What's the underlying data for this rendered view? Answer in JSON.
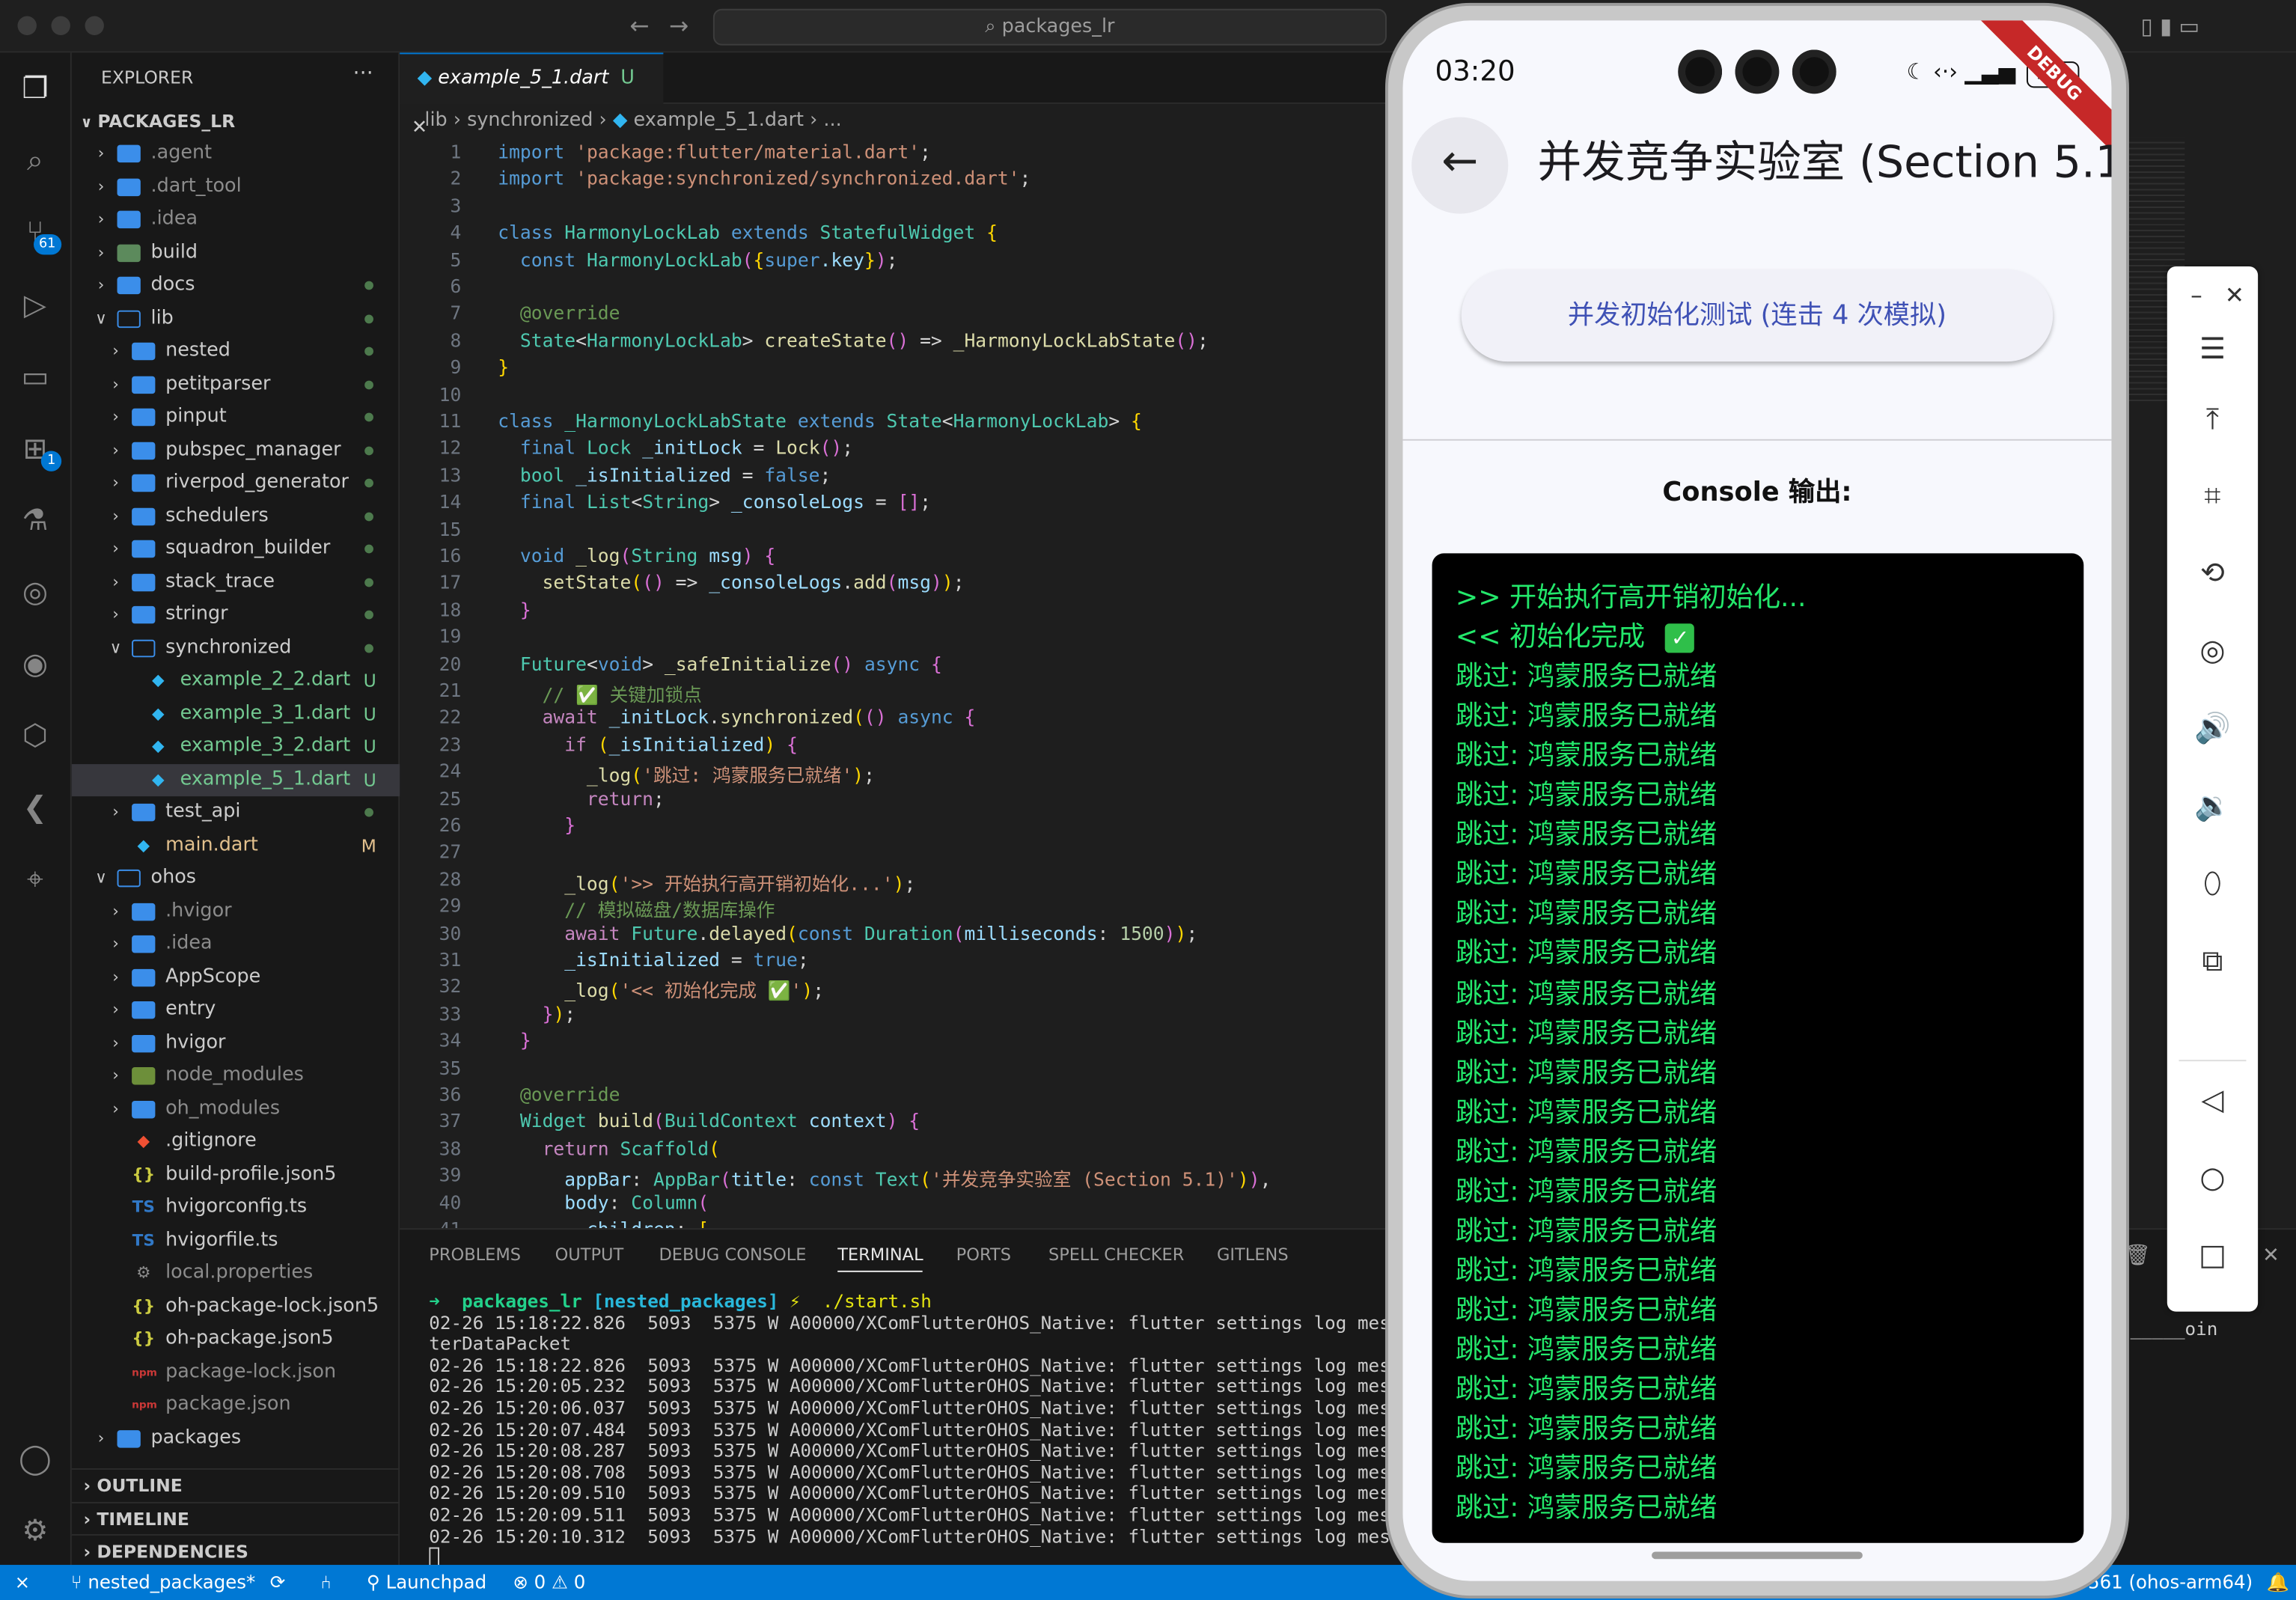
{
  "window": {
    "search": "packages_lr"
  },
  "colors": {
    "accent": "#0078d4",
    "console_text": "#23e86b",
    "folder": "#3b8eea"
  },
  "activity_bar": {
    "scm_badge": "61",
    "ext_badge": "1"
  },
  "explorer": {
    "title": "EXPLORER",
    "root": "PACKAGES_LR",
    "items": [
      {
        "name": ".agent",
        "depth": 1,
        "kind": "folder"
      },
      {
        "name": ".dart_tool",
        "depth": 1,
        "kind": "folder"
      },
      {
        "name": ".idea",
        "depth": 1,
        "kind": "folder"
      },
      {
        "name": "build",
        "depth": 1,
        "kind": "folder-build"
      },
      {
        "name": "docs",
        "depth": 1,
        "kind": "folder",
        "dot": true
      },
      {
        "name": "lib",
        "depth": 1,
        "kind": "folder-open",
        "dot": true
      },
      {
        "name": "nested",
        "depth": 2,
        "kind": "folder",
        "dot": true
      },
      {
        "name": "petitparser",
        "depth": 2,
        "kind": "folder",
        "dot": true
      },
      {
        "name": "pinput",
        "depth": 2,
        "kind": "folder",
        "dot": true
      },
      {
        "name": "pubspec_manager",
        "depth": 2,
        "kind": "folder",
        "dot": true
      },
      {
        "name": "riverpod_generator",
        "depth": 2,
        "kind": "folder",
        "dot": true
      },
      {
        "name": "schedulers",
        "depth": 2,
        "kind": "folder",
        "dot": true
      },
      {
        "name": "squadron_builder",
        "depth": 2,
        "kind": "folder",
        "dot": true
      },
      {
        "name": "stack_trace",
        "depth": 2,
        "kind": "folder",
        "dot": true
      },
      {
        "name": "stringr",
        "depth": 2,
        "kind": "folder",
        "dot": true
      },
      {
        "name": "synchronized",
        "depth": 2,
        "kind": "folder-open",
        "dot": true
      },
      {
        "name": "example_2_2.dart",
        "depth": 3,
        "kind": "dart",
        "status": "U"
      },
      {
        "name": "example_3_1.dart",
        "depth": 3,
        "kind": "dart",
        "status": "U"
      },
      {
        "name": "example_3_2.dart",
        "depth": 3,
        "kind": "dart",
        "status": "U"
      },
      {
        "name": "example_5_1.dart",
        "depth": 3,
        "kind": "dart",
        "status": "U",
        "selected": true
      },
      {
        "name": "test_api",
        "depth": 2,
        "kind": "folder",
        "dot": true
      },
      {
        "name": "main.dart",
        "depth": 2,
        "kind": "dart-file",
        "status": "M"
      },
      {
        "name": "ohos",
        "depth": 1,
        "kind": "folder-open"
      },
      {
        "name": ".hvigor",
        "depth": 2,
        "kind": "folder"
      },
      {
        "name": ".idea",
        "depth": 2,
        "kind": "folder"
      },
      {
        "name": "AppScope",
        "depth": 2,
        "kind": "folder"
      },
      {
        "name": "entry",
        "depth": 2,
        "kind": "folder"
      },
      {
        "name": "hvigor",
        "depth": 2,
        "kind": "folder"
      },
      {
        "name": "node_modules",
        "depth": 2,
        "kind": "folder-node"
      },
      {
        "name": "oh_modules",
        "depth": 2,
        "kind": "folder"
      },
      {
        "name": ".gitignore",
        "depth": 2,
        "kind": "git"
      },
      {
        "name": "build-profile.json5",
        "depth": 2,
        "kind": "json"
      },
      {
        "name": "hvigorconfig.ts",
        "depth": 2,
        "kind": "ts"
      },
      {
        "name": "hvigorfile.ts",
        "depth": 2,
        "kind": "ts"
      },
      {
        "name": "local.properties",
        "depth": 2,
        "kind": "gear"
      },
      {
        "name": "oh-package-lock.json5",
        "depth": 2,
        "kind": "json"
      },
      {
        "name": "oh-package.json5",
        "depth": 2,
        "kind": "json"
      },
      {
        "name": "package-lock.json",
        "depth": 2,
        "kind": "npm"
      },
      {
        "name": "package.json",
        "depth": 2,
        "kind": "npm"
      },
      {
        "name": "packages",
        "depth": 1,
        "kind": "folder"
      }
    ],
    "sections": [
      "OUTLINE",
      "TIMELINE",
      "DEPENDENCIES"
    ]
  },
  "editor": {
    "tab_name": "example_5_1.dart",
    "tab_status": "U",
    "breadcrumb": [
      "lib",
      "synchronized",
      "example_5_1.dart",
      "..."
    ],
    "lines": [
      [
        [
          "k",
          "import "
        ],
        [
          "s",
          "'package:flutter/material.dart'"
        ],
        [
          "",
          "; "
        ]
      ],
      [
        [
          "k",
          "import "
        ],
        [
          "s",
          "'package:synchronized/synchronized.dart'"
        ],
        [
          "",
          ";"
        ]
      ],
      [],
      [
        [
          "k",
          "class "
        ],
        [
          "t",
          "HarmonyLockLab "
        ],
        [
          "k",
          "extends "
        ],
        [
          "t",
          "StatefulWidget "
        ],
        [
          "y",
          "{"
        ]
      ],
      [
        [
          "",
          ""
        ],
        [
          "k",
          "  const "
        ],
        [
          "t",
          "HarmonyLockLab"
        ],
        [
          "m",
          "("
        ],
        [
          "y",
          "{"
        ],
        [
          "k",
          "super"
        ],
        [
          "v",
          ".key"
        ],
        [
          "y",
          "}"
        ],
        [
          "m",
          ")"
        ],
        [
          "",
          ";"
        ]
      ],
      [],
      [
        [
          "c",
          "  @override"
        ]
      ],
      [
        [
          "t",
          "  State"
        ],
        [
          "",
          "<"
        ],
        [
          "t",
          "HarmonyLockLab"
        ],
        [
          "",
          "> "
        ],
        [
          "f",
          "createState"
        ],
        [
          "m",
          "()"
        ],
        [
          "",
          " => "
        ],
        [
          "f",
          "_HarmonyLockLabState"
        ],
        [
          "m",
          "()"
        ],
        [
          "",
          ";"
        ]
      ],
      [
        [
          "y",
          "}"
        ]
      ],
      [],
      [
        [
          "k",
          "class "
        ],
        [
          "t",
          "_HarmonyLockLabState "
        ],
        [
          "k",
          "extends "
        ],
        [
          "t",
          "State"
        ],
        [
          "",
          "<"
        ],
        [
          "t",
          "HarmonyLockLab"
        ],
        [
          "",
          "> "
        ],
        [
          "y",
          "{"
        ]
      ],
      [
        [
          "k",
          "  final "
        ],
        [
          "t",
          "Lock "
        ],
        [
          "v",
          "_initLock"
        ],
        [
          "",
          " = "
        ],
        [
          "f",
          "Lock"
        ],
        [
          "m",
          "()"
        ],
        [
          "",
          ";"
        ]
      ],
      [
        [
          "t",
          "  bool "
        ],
        [
          "v",
          "_isInitialized"
        ],
        [
          "",
          " = "
        ],
        [
          "k",
          "false"
        ],
        [
          "",
          ";"
        ]
      ],
      [
        [
          "k",
          "  final "
        ],
        [
          "t",
          "List"
        ],
        [
          "",
          "<"
        ],
        [
          "t",
          "String"
        ],
        [
          "",
          "> "
        ],
        [
          "v",
          "_consoleLogs"
        ],
        [
          "",
          " = "
        ],
        [
          "m",
          "[]"
        ],
        [
          "",
          ";"
        ]
      ],
      [],
      [
        [
          "k",
          "  void "
        ],
        [
          "f",
          "_log"
        ],
        [
          "m",
          "("
        ],
        [
          "t",
          "String "
        ],
        [
          "v",
          "msg"
        ],
        [
          "m",
          ")"
        ],
        [
          "",
          " "
        ],
        [
          "m",
          "{"
        ]
      ],
      [
        [
          "f",
          "    setState"
        ],
        [
          "y",
          "("
        ],
        [
          "m",
          "()"
        ],
        [
          "",
          " => "
        ],
        [
          "v",
          "_consoleLogs"
        ],
        [
          "",
          ".",
          ""
        ],
        [
          "f",
          "add"
        ],
        [
          "m",
          "("
        ],
        [
          "v",
          "msg"
        ],
        [
          "m",
          ")"
        ],
        [
          "y",
          ")"
        ],
        [
          "",
          ";"
        ]
      ],
      [
        [
          "m",
          "  }"
        ]
      ],
      [],
      [
        [
          "t",
          "  Future"
        ],
        [
          "",
          "<"
        ],
        [
          "k",
          "void"
        ],
        [
          "",
          "> "
        ],
        [
          "f",
          "_safeInitialize"
        ],
        [
          "m",
          "()"
        ],
        [
          "k",
          " async "
        ],
        [
          "m",
          "{"
        ]
      ],
      [
        [
          "c",
          "    // ✅ 关键加锁点"
        ]
      ],
      [
        [
          "p",
          "    await "
        ],
        [
          "v",
          "_initLock"
        ],
        [
          "",
          "."
        ],
        [
          "f",
          "synchronized"
        ],
        [
          "y",
          "("
        ],
        [
          "m",
          "()"
        ],
        [
          "k",
          " async "
        ],
        [
          "m",
          "{"
        ]
      ],
      [
        [
          "p",
          "      if "
        ],
        [
          "y",
          "("
        ],
        [
          "v",
          "_isInitialized"
        ],
        [
          "y",
          ")"
        ],
        [
          "",
          " "
        ],
        [
          "m",
          "{"
        ]
      ],
      [
        [
          "f",
          "        _log"
        ],
        [
          "y",
          "("
        ],
        [
          "s",
          "'跳过: 鸿蒙服务已就绪'"
        ],
        [
          "y",
          ")"
        ],
        [
          "",
          ";"
        ]
      ],
      [
        [
          "p",
          "        return"
        ],
        [
          "",
          ";"
        ]
      ],
      [
        [
          "m",
          "      }"
        ]
      ],
      [],
      [
        [
          "f",
          "      _log"
        ],
        [
          "y",
          "("
        ],
        [
          "s",
          "'>> 开始执行高开销初始化...'"
        ],
        [
          "y",
          ")"
        ],
        [
          "",
          ";"
        ]
      ],
      [
        [
          "c",
          "      // 模拟磁盘/数据库操作"
        ]
      ],
      [
        [
          "p",
          "      await "
        ],
        [
          "t",
          "Future"
        ],
        [
          "",
          "."
        ],
        [
          "f",
          "delayed"
        ],
        [
          "y",
          "("
        ],
        [
          "k",
          "const "
        ],
        [
          "t",
          "Duration"
        ],
        [
          "m",
          "("
        ],
        [
          "v",
          "milliseconds"
        ],
        [
          "",
          ": "
        ],
        [
          "n",
          "1500"
        ],
        [
          "m",
          ")"
        ],
        [
          "y",
          ")"
        ],
        [
          "",
          ";"
        ]
      ],
      [
        [
          "v",
          "      _isInitialized"
        ],
        [
          "",
          " = "
        ],
        [
          "k",
          "true"
        ],
        [
          "",
          ";"
        ]
      ],
      [
        [
          "f",
          "      _log"
        ],
        [
          "y",
          "("
        ],
        [
          "s",
          "'<< 初始化完成 ✅'"
        ],
        [
          "y",
          ")"
        ],
        [
          "",
          ";"
        ]
      ],
      [
        [
          "m",
          "    }"
        ],
        [
          "y",
          ")"
        ],
        [
          "",
          ";"
        ]
      ],
      [
        [
          "m",
          "  }"
        ]
      ],
      [],
      [
        [
          "c",
          "  @override"
        ]
      ],
      [
        [
          "t",
          "  Widget "
        ],
        [
          "f",
          "build"
        ],
        [
          "m",
          "("
        ],
        [
          "t",
          "BuildContext "
        ],
        [
          "v",
          "context"
        ],
        [
          "m",
          ")"
        ],
        [
          "",
          " "
        ],
        [
          "m",
          "{"
        ]
      ],
      [
        [
          "p",
          "    return "
        ],
        [
          "t",
          "Scaffold"
        ],
        [
          "y",
          "("
        ]
      ],
      [
        [
          "v",
          "      appBar"
        ],
        [
          "",
          ": "
        ],
        [
          "t",
          "AppBar"
        ],
        [
          "m",
          "("
        ],
        [
          "v",
          "title"
        ],
        [
          "",
          ": "
        ],
        [
          "k",
          "const "
        ],
        [
          "t",
          "Text"
        ],
        [
          "y",
          "("
        ],
        [
          "s",
          "'并发竞争实验室 (Section 5.1)'"
        ],
        [
          "y",
          ")"
        ],
        [
          "m",
          ")"
        ],
        [
          "",
          ","
        ]
      ],
      [
        [
          "v",
          "      body"
        ],
        [
          "",
          ": "
        ],
        [
          "t",
          "Column"
        ],
        [
          "m",
          "("
        ]
      ],
      [
        [
          "v",
          "        children"
        ],
        [
          "",
          ": "
        ],
        [
          "y",
          "["
        ]
      ]
    ]
  },
  "panel": {
    "tabs": [
      "PROBLEMS",
      "OUTPUT",
      "DEBUG CONSOLE",
      "TERMINAL",
      "PORTS",
      "SPELL CHECKER",
      "GITLENS"
    ],
    "active_tab": "TERMINAL",
    "prompt_dir": "packages_lr",
    "prompt_branch": "[nested_packages]",
    "prompt_cmd": "./start.sh",
    "log_lines": [
      "02-26 15:18:22.826  5093  5375 W A00000/XComFlutterOHOS_Native: flutter settings log message",
      "terDataPacket",
      "02-26 15:18:22.826  5093  5375 W A00000/XComFlutterOHOS_Native: flutter settings log message",
      "02-26 15:20:05.232  5093  5375 W A00000/XComFlutterOHOS_Native: flutter settings log message",
      "02-26 15:20:06.037  5093  5375 W A00000/XComFlutterOHOS_Native: flutter settings log message",
      "02-26 15:20:07.484  5093  5375 W A00000/XComFlutterOHOS_Native: flutter settings log message",
      "02-26 15:20:08.287  5093  5375 W A00000/XComFlutterOHOS_Native: flutter settings log message",
      "02-26 15:20:08.708  5093  5375 W A00000/XComFlutterOHOS_Native: flutter settings log message",
      "02-26 15:20:09.510  5093  5375 W A00000/XComFlutterOHOS_Native: flutter settings log message",
      "02-26 15:20:09.511  5093  5375 W A00000/XComFlutterOHOS_Native: flutter settings log message",
      "02-26 15:20:10.312  5093  5375 W A00000/XComFlutterOHOS_Native: flutter settings log message"
    ],
    "right_fragment": "ing._____oin"
  },
  "status_bar": {
    "branch": "nested_packages*",
    "launchpad": "Launchpad",
    "errors": "0",
    "warnings": "0",
    "device": "5561 (ohos-arm64)"
  },
  "phone": {
    "time": "03:20",
    "battery": "100",
    "debug_banner": "DEBUG",
    "app_title": "并发竞争实验室 (Section 5.1)",
    "button_label": "并发初始化测试 (连击 4 次模拟)",
    "console_label": "Console 输出:",
    "console_lines": [
      ">> 开始执行高开销初始化...",
      "<< 初始化完成",
      "跳过: 鸿蒙服务已就绪",
      "跳过: 鸿蒙服务已就绪",
      "跳过: 鸿蒙服务已就绪",
      "跳过: 鸿蒙服务已就绪",
      "跳过: 鸿蒙服务已就绪",
      "跳过: 鸿蒙服务已就绪",
      "跳过: 鸿蒙服务已就绪",
      "跳过: 鸿蒙服务已就绪",
      "跳过: 鸿蒙服务已就绪",
      "跳过: 鸿蒙服务已就绪",
      "跳过: 鸿蒙服务已就绪",
      "跳过: 鸿蒙服务已就绪",
      "跳过: 鸿蒙服务已就绪",
      "跳过: 鸿蒙服务已就绪",
      "跳过: 鸿蒙服务已就绪",
      "跳过: 鸿蒙服务已就绪",
      "跳过: 鸿蒙服务已就绪",
      "跳过: 鸿蒙服务已就绪",
      "跳过: 鸿蒙服务已就绪",
      "跳过: 鸿蒙服务已就绪",
      "跳过: 鸿蒙服务已就绪",
      "跳过: 鸿蒙服务已就绪"
    ]
  }
}
